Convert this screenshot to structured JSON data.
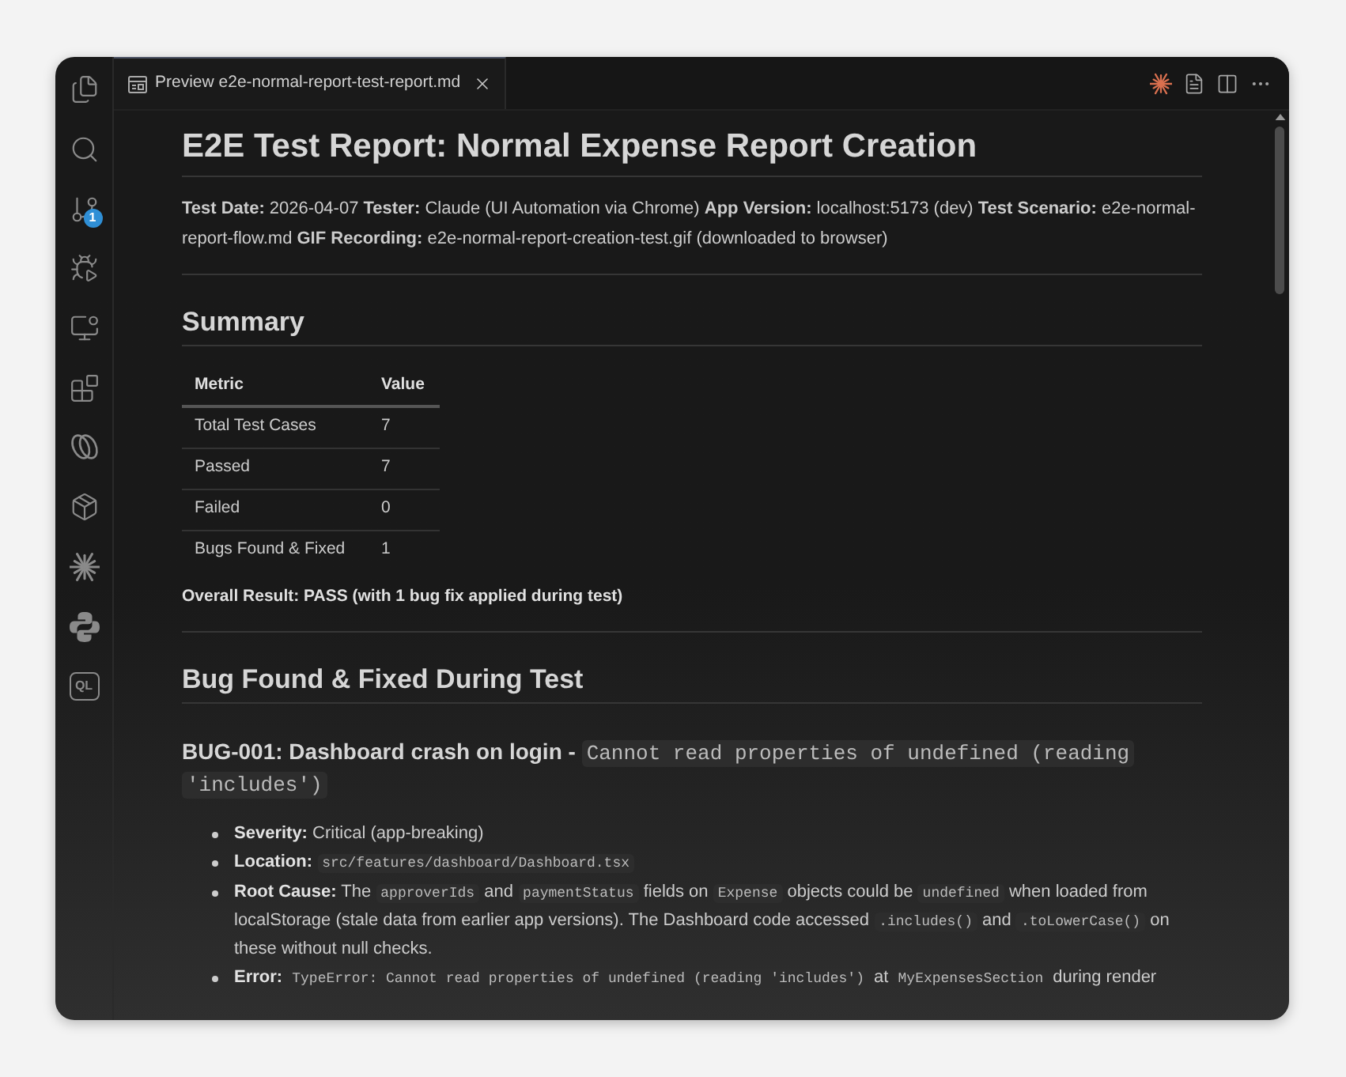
{
  "activity_bar": {
    "source_control_badge": "1",
    "last_item_label": "QL"
  },
  "tabs": [
    {
      "label": "Preview e2e-normal-report-test-report.md",
      "selected": true
    }
  ],
  "document": {
    "title": "E2E Test Report: Normal Expense Report Creation",
    "meta": "**Test Date:** 2026-04-07 **Tester:** Claude (UI Automation via Chrome) **App Version:** localhost:5173 (dev) **Test Scenario:** e2e-normal-report-flow.md **GIF Recording:** e2e-normal-report-creation-test.gif (downloaded to browser)",
    "sections": [
      {
        "heading": "Summary",
        "table": {
          "columns": [
            "Metric",
            "Value"
          ],
          "rows": [
            [
              "Total Test Cases",
              "7"
            ],
            [
              "Passed",
              "7"
            ],
            [
              "Failed",
              "0"
            ],
            [
              "Bugs Found & Fixed",
              "1"
            ]
          ]
        },
        "result": "Overall Result: PASS (with 1 bug fix applied during test)"
      },
      {
        "heading": "Bug Found & Fixed During Test",
        "subheading": [
          {
            "kind": "text",
            "text": "BUG-001: Dashboard crash on login - "
          },
          {
            "kind": "code",
            "text": "Cannot read properties of undefined (reading 'includes')"
          }
        ],
        "bullets": [
          [
            {
              "kind": "bold",
              "text": "Severity:"
            },
            {
              "kind": "text",
              "text": " Critical (app-breaking)"
            }
          ],
          [
            {
              "kind": "bold",
              "text": "Location: "
            },
            {
              "kind": "code",
              "text": "src/features/dashboard/Dashboard.tsx"
            }
          ],
          [
            {
              "kind": "bold",
              "text": "Root Cause:"
            },
            {
              "kind": "text",
              "text": " The "
            },
            {
              "kind": "code",
              "text": "approverIds"
            },
            {
              "kind": "text",
              "text": " and "
            },
            {
              "kind": "code",
              "text": "paymentStatus"
            },
            {
              "kind": "text",
              "text": " fields on "
            },
            {
              "kind": "code",
              "text": "Expense"
            },
            {
              "kind": "text",
              "text": " objects could be "
            },
            {
              "kind": "code",
              "text": "undefined"
            },
            {
              "kind": "text",
              "text": " when loaded from localStorage (stale data from earlier app versions). The Dashboard code accessed "
            },
            {
              "kind": "code",
              "text": ".includes()"
            },
            {
              "kind": "text",
              "text": " and "
            },
            {
              "kind": "code",
              "text": ".toLowerCase()"
            },
            {
              "kind": "text",
              "text": " on these without null checks."
            }
          ],
          [
            {
              "kind": "bold",
              "text": "Error: "
            },
            {
              "kind": "code",
              "text": "TypeError: Cannot read properties of undefined (reading 'includes')"
            },
            {
              "kind": "text",
              "text": " at "
            },
            {
              "kind": "code",
              "text": "MyExpensesSection"
            },
            {
              "kind": "text",
              "text": " during render"
            }
          ]
        ]
      }
    ]
  }
}
